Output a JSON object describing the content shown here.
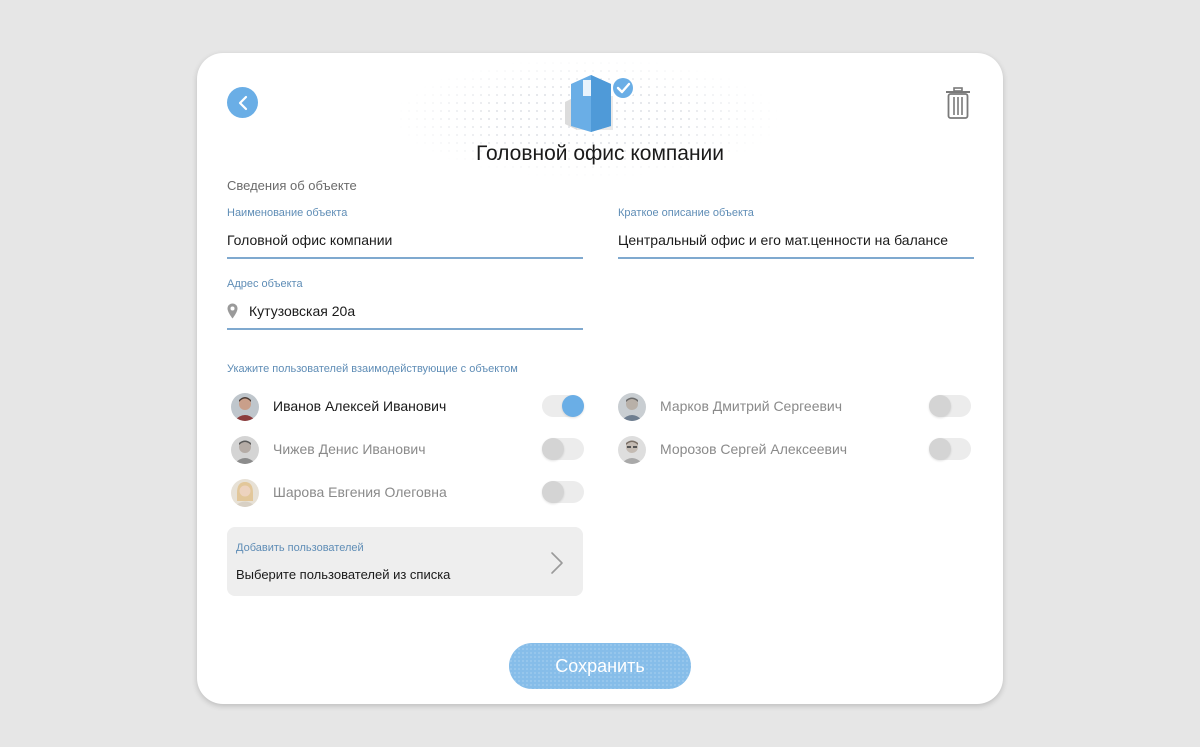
{
  "header": {
    "title": "Головной офис компании",
    "back_icon": "chevron-left-icon",
    "delete_icon": "trash-icon",
    "hero_icon": "box-check-icon"
  },
  "form": {
    "section_label": "Сведения об объекте",
    "name": {
      "label": "Наименование объекта",
      "value": "Головной офис компании"
    },
    "description": {
      "label": "Краткое описание объекта",
      "value": "Центральный офис и его мат.ценности на балансе"
    },
    "address": {
      "label": "Адрес объекта",
      "value": "Кутузовская 20а",
      "icon": "location-pin-icon"
    }
  },
  "users": {
    "label": "Укажите пользователей взаимодействующие с объектом",
    "items": [
      {
        "name": "Иванов Алексей Иванович",
        "enabled": true
      },
      {
        "name": "Марков Дмитрий Сергеевич",
        "enabled": false
      },
      {
        "name": "Чижев Денис Иванович",
        "enabled": false
      },
      {
        "name": "Морозов Сергей Алексеевич",
        "enabled": false
      },
      {
        "name": "Шарова Евгения Олеговна",
        "enabled": false
      }
    ]
  },
  "add_users": {
    "label": "Добавить пользователей",
    "value": "Выберите пользователей из списка",
    "icon": "chevron-right-icon"
  },
  "save_button": {
    "label": "Сохранить"
  },
  "colors": {
    "accent": "#6aaee6",
    "field_label": "#5f8db6",
    "underline": "#7fa9cf",
    "background": "#e6e6e6",
    "card": "#ffffff"
  }
}
